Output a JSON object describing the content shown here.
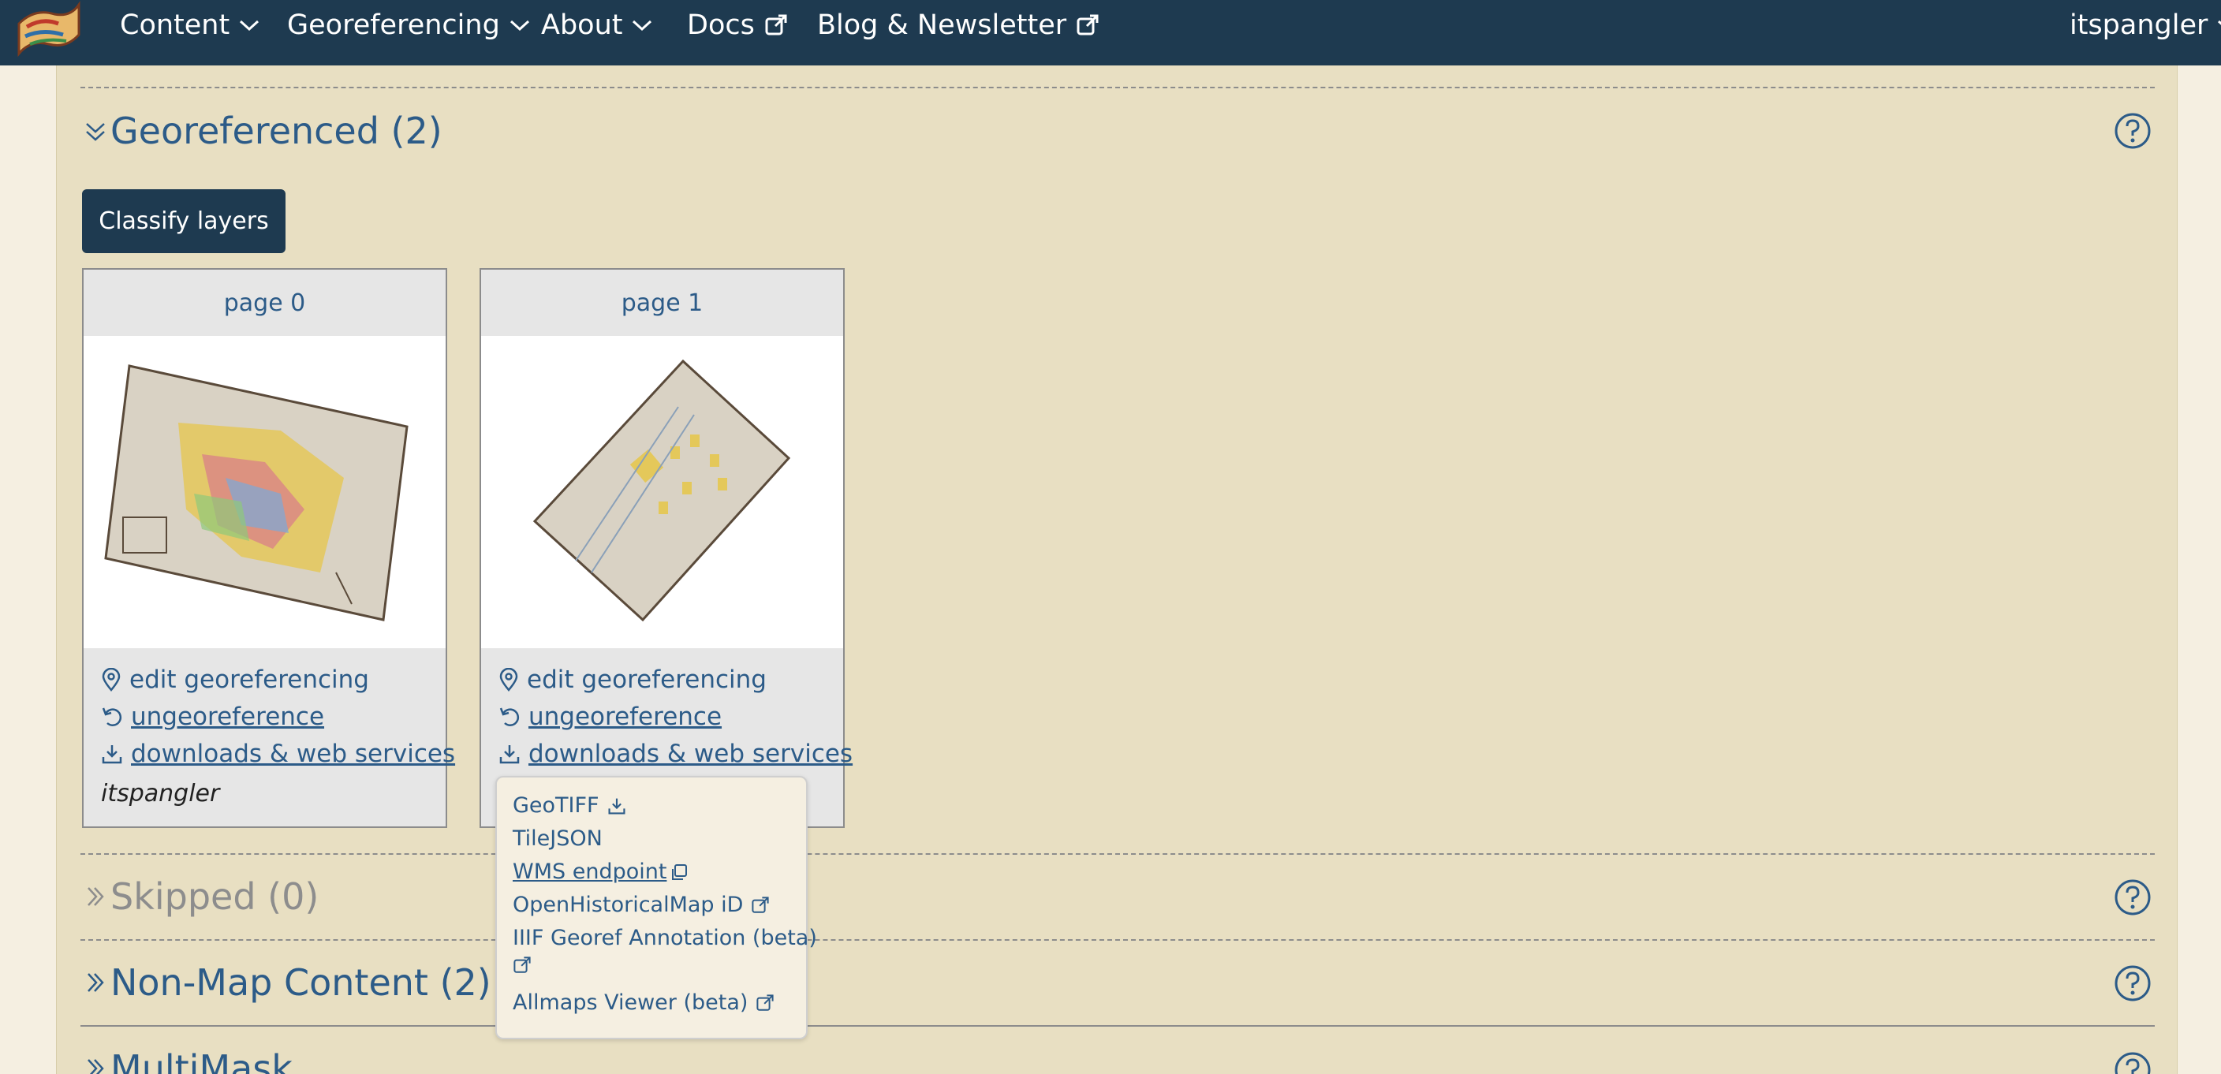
{
  "navbar": {
    "items": [
      {
        "label": "Content"
      },
      {
        "label": "Georeferencing"
      },
      {
        "label": "About"
      },
      {
        "label": "Docs"
      },
      {
        "label": "Blog & Newsletter"
      }
    ],
    "user": "itspangler"
  },
  "sections": {
    "georeferenced": {
      "title": "Georeferenced (2)"
    },
    "skipped": {
      "title": "Skipped (0)"
    },
    "nonmap": {
      "title": "Non-Map Content (2)"
    },
    "multimask": {
      "title": "MultiMask"
    }
  },
  "classify_button": "Classify layers",
  "cards": [
    {
      "title": "page 0",
      "edit": "edit georeferencing",
      "ungeo": " ungeoreference",
      "downloads": " downloads & web services",
      "user": "itspangler"
    },
    {
      "title": "page 1",
      "edit": "edit georeferencing",
      "ungeo": " ungeoreference",
      "downloads": " downloads & web services"
    }
  ],
  "dropdown": {
    "items": [
      {
        "label": "GeoTIFF",
        "icon": "download-icon"
      },
      {
        "label": "TileJSON"
      },
      {
        "label": "WMS endpoint ",
        "icon": "copy-icon"
      },
      {
        "label": "OpenHistoricalMap iD",
        "icon": "external-link-icon"
      },
      {
        "label": "IIIF Georef Annotation (beta)",
        "icon": "external-link-icon"
      },
      {
        "label": "Allmaps Viewer (beta)",
        "icon": "external-link-icon"
      }
    ]
  },
  "colors": {
    "navbar": "#1e3a50",
    "panel": "#e8dfc2",
    "link": "#2c5b88"
  }
}
